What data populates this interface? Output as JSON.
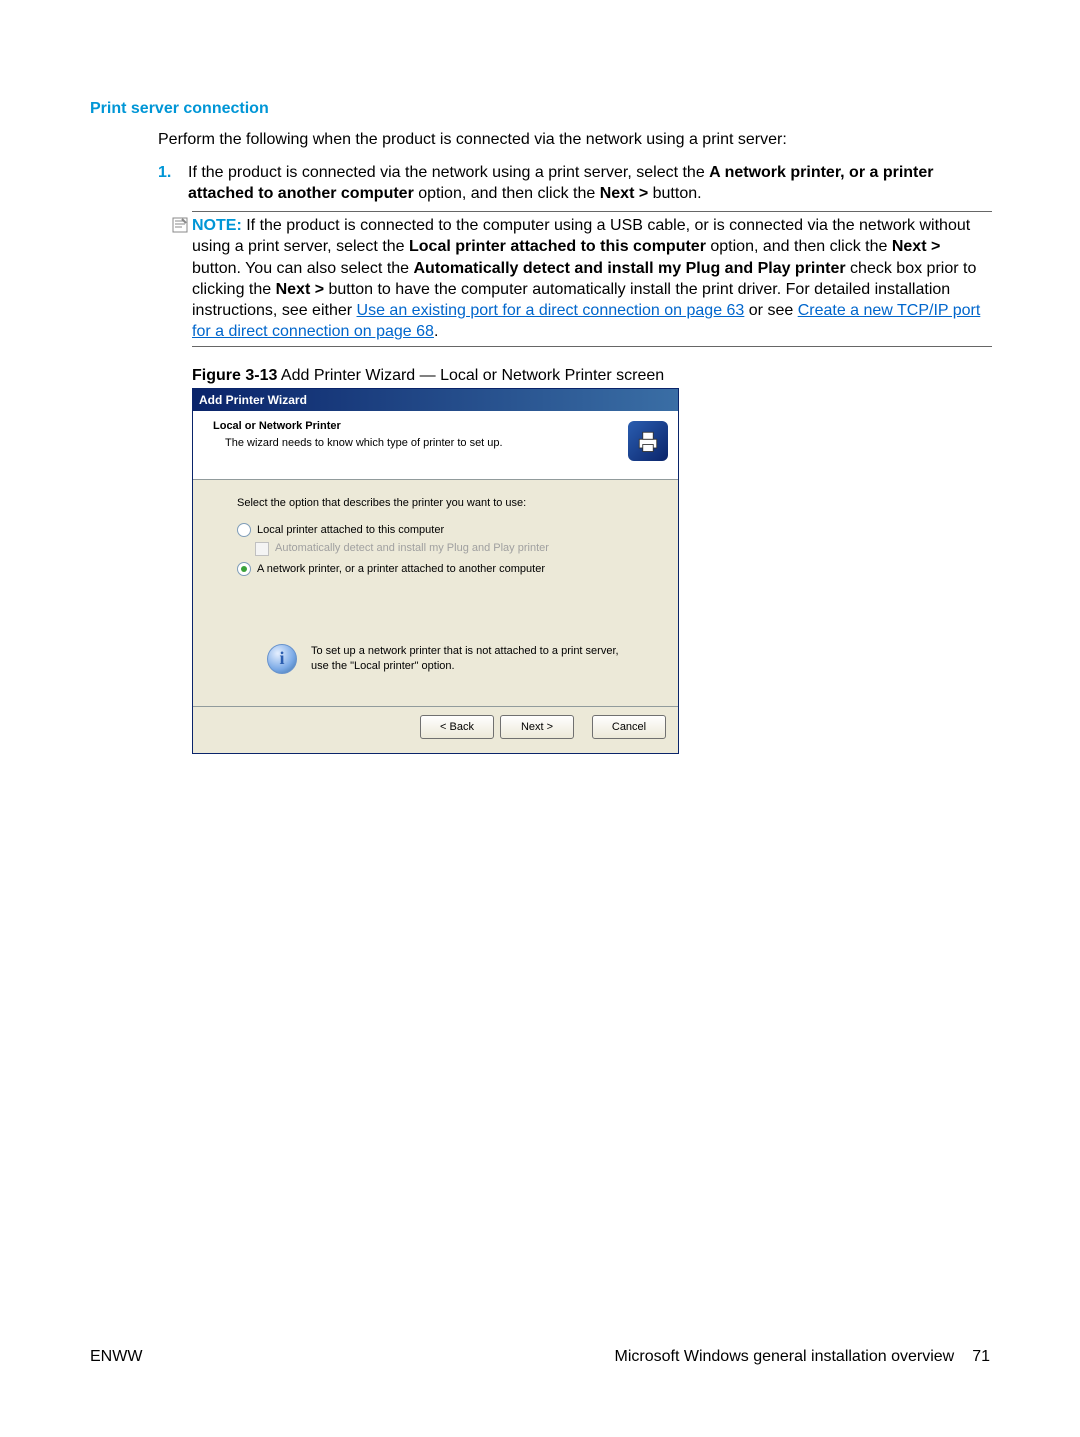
{
  "heading": "Print server connection",
  "intro": "Perform the following when the product is connected via the network using a print server:",
  "step": {
    "num": "1.",
    "pre": "If the product is connected via the network using a print server, select the ",
    "bold1": "A network printer, or a printer attached to another computer",
    "mid1": " option, and then click the ",
    "bold2": "Next >",
    "post": " button."
  },
  "note": {
    "label": "NOTE:",
    "seg1": "If the product is connected to the computer using a USB cable, or is connected via the network without using a print server, select the ",
    "bold1": "Local printer attached to this computer",
    "seg2": " option, and then click the ",
    "bold2": "Next >",
    "seg3": " button. You can also select the ",
    "bold3": "Automatically detect and install my Plug and Play printer",
    "seg4": " check box prior to clicking the ",
    "bold4": "Next >",
    "seg5": " button to have the computer automatically install the print driver. For detailed installation instructions, see either ",
    "link1": "Use an existing port for a direct connection on page 63",
    "seg6": " or see ",
    "link2": "Create a new TCP/IP port for a direct connection on page 68",
    "seg7": "."
  },
  "figure": {
    "prefix": "Figure 3-13",
    "title": "  Add Printer Wizard — Local or Network Printer screen"
  },
  "wizard": {
    "title": "Add Printer Wizard",
    "headerTitle": "Local or Network Printer",
    "headerSub": "The wizard needs to know which type of printer to set up.",
    "prompt": "Select the option that describes the printer you want to use:",
    "opt1": "Local printer attached to this computer",
    "opt1sub": "Automatically detect and install my Plug and Play printer",
    "opt2": "A network printer, or a printer attached to another computer",
    "info": "To set up a network printer that is not attached to a print server, use the \"Local printer\" option.",
    "backBtn": "< Back",
    "nextBtn": "Next >",
    "cancelBtn": "Cancel"
  },
  "footer": {
    "left": "ENWW",
    "rightText": "Microsoft Windows general installation overview",
    "pageNum": "71"
  }
}
